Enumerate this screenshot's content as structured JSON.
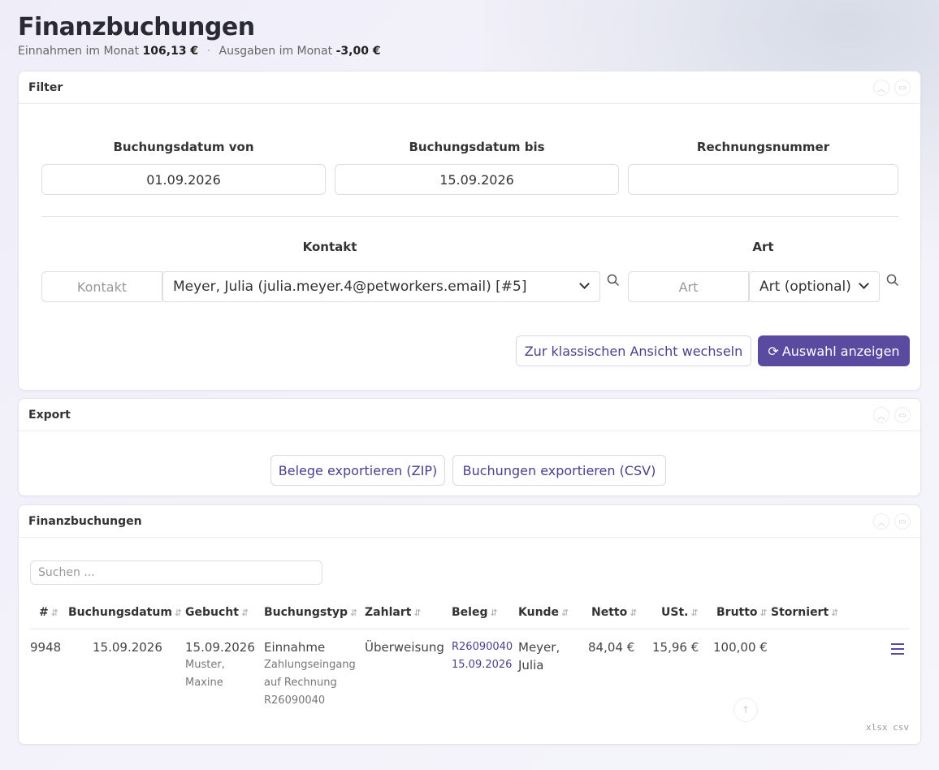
{
  "header": {
    "title": "Finanzbuchungen",
    "income_label": "Einnahmen im Monat",
    "income_value": "106,13 €",
    "separator": "·",
    "expense_label": "Ausgaben im Monat",
    "expense_value": "-3,00 €"
  },
  "filter": {
    "title": "Filter",
    "date_from_label": "Buchungsdatum von",
    "date_from_value": "01.09.2026",
    "date_to_label": "Buchungsdatum bis",
    "date_to_value": "15.09.2026",
    "invoice_label": "Rechnungsnummer",
    "invoice_value": "",
    "contact_label": "Kontakt",
    "contact_placeholder": "Kontakt",
    "contact_selected": "Meyer, Julia (julia.meyer.4@petworkers.email) [#5]",
    "type_label": "Art",
    "type_placeholder": "Art",
    "type_selected": "Art (optional)",
    "classic_view_button": "Zur klassischen Ansicht wechseln",
    "apply_button": "Auswahl anzeigen"
  },
  "export": {
    "title": "Export",
    "zip_button": "Belege exportieren (ZIP)",
    "csv_button": "Buchungen exportieren (CSV)"
  },
  "bookings": {
    "title": "Finanzbuchungen",
    "search_placeholder": "Suchen ...",
    "sort_icon": "⇵",
    "columns": [
      "#",
      "Buchungsdatum",
      "Gebucht",
      "Buchungstyp",
      "Zahlart",
      "Beleg",
      "Kunde",
      "Netto",
      "USt.",
      "Brutto",
      "Storniert"
    ],
    "rows": [
      {
        "id": "9948",
        "booking_date": "15.09.2026",
        "booked_date": "15.09.2026",
        "booked_by_line1": "Muster,",
        "booked_by_line2": "Maxine",
        "type": "Einnahme",
        "type_desc_line1": "Zahlungseingang",
        "type_desc_line2": "auf Rechnung",
        "type_desc_line3": "R26090040",
        "payment_method": "Überweisung",
        "receipt_number": "R26090040",
        "receipt_date": "15.09.2026",
        "customer_line1": "Meyer,",
        "customer_line2": "Julia",
        "net": "84,04 €",
        "vat": "15,96 €",
        "gross": "100,00 €",
        "cancelled": ""
      }
    ],
    "export_links": "xlsx csv"
  },
  "colors": {
    "primary": "#5a4aa0",
    "link": "#4b3f8f"
  }
}
